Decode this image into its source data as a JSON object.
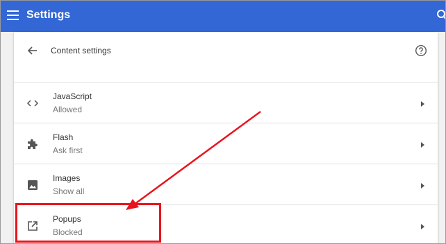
{
  "topbar": {
    "title": "Settings",
    "menu_icon": "hamburger-menu-icon",
    "search_icon": "search-icon",
    "background_color": "#3367d6"
  },
  "header": {
    "title": "Content settings",
    "back_icon": "back-arrow-icon",
    "help_icon": "help-circle-icon"
  },
  "rows": [
    {
      "icon": "code-brackets-icon",
      "title": "JavaScript",
      "status": "Allowed"
    },
    {
      "icon": "puzzle-piece-icon",
      "title": "Flash",
      "status": "Ask first"
    },
    {
      "icon": "image-icon",
      "title": "Images",
      "status": "Show all"
    },
    {
      "icon": "open-in-new-icon",
      "title": "Popups",
      "status": "Blocked"
    }
  ],
  "annotation": {
    "highlight_color": "#e8141c",
    "target": "Popups"
  }
}
